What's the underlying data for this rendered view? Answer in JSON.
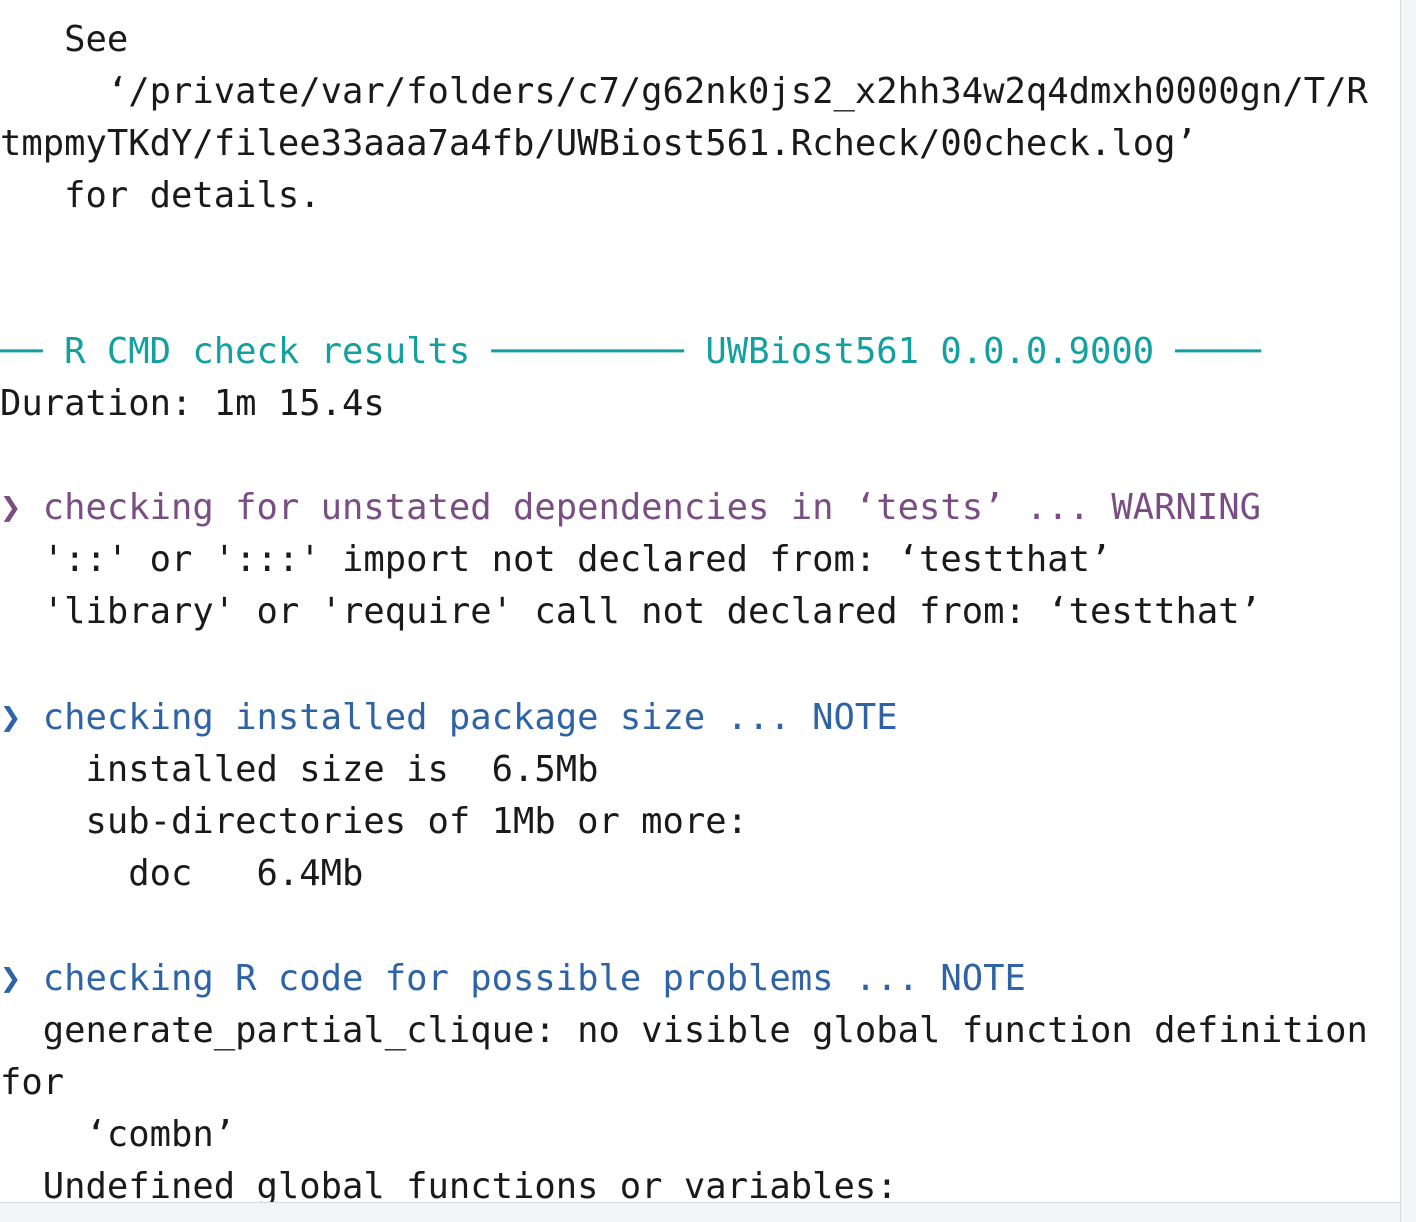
{
  "console": {
    "log_hint": {
      "see": "   See",
      "path_line1": "     ‘/private/var/folders/c7/g62nk0js2_x2hh34w2q4dmxh0000gn/T/R",
      "path_line2": "tmpmyTKdY/filee33aaa7a4fb/UWBiost561.Rcheck/00check.log’",
      "details": "   for details."
    },
    "results_header": {
      "left_rule": "── ",
      "title": "R CMD check results",
      "mid_rule": " ───────── ",
      "package": "UWBiost561 0.0.0.9000",
      "right_rule": " ────"
    },
    "duration": "Duration: 1m 15.4s",
    "checks": [
      {
        "marker": "❯",
        "heading": " checking for unstated dependencies in ‘tests’ ... WARNING",
        "status": "WARNING",
        "color": "#7a4e83",
        "details": [
          "  '::' or ':::' import not declared from: ‘testthat’",
          "  'library' or 'require' call not declared from: ‘testthat’"
        ]
      },
      {
        "marker": "❯",
        "heading": " checking installed package size ... NOTE",
        "status": "NOTE",
        "color": "#2e63a6",
        "details": [
          "    installed size is  6.5Mb",
          "    sub-directories of 1Mb or more:",
          "      doc   6.4Mb"
        ]
      },
      {
        "marker": "❯",
        "heading": " checking R code for possible problems ... NOTE",
        "status": "NOTE",
        "color": "#2e63a6",
        "details": [
          "  generate_partial_clique: no visible global function definition",
          "for",
          "    ‘combn’",
          "  Undefined global functions or variables:"
        ]
      }
    ]
  },
  "colors": {
    "rule": "#13a0a0",
    "warning": "#7a4e83",
    "note": "#2e63a6",
    "text": "#1a1a1a"
  }
}
